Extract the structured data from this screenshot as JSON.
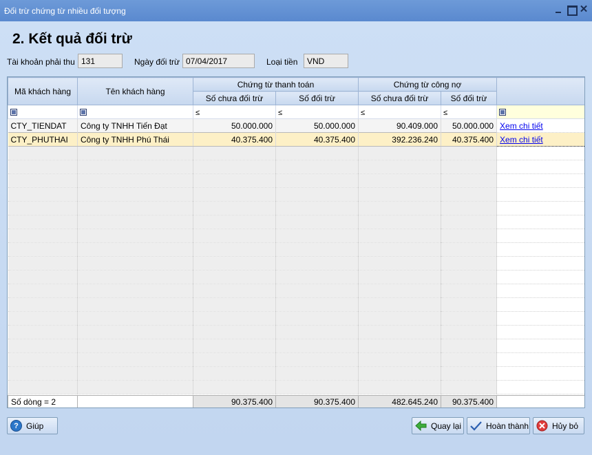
{
  "window": {
    "title": "Đối trừ chứng từ nhiều đối tượng"
  },
  "heading": "2. Kết quả đối trừ",
  "fields": {
    "account_label": "Tài khoản phải thu",
    "account_value": "131",
    "date_label": "Ngày đối trừ",
    "date_value": "07/04/2017",
    "currency_label": "Loại tiền",
    "currency_value": "VND"
  },
  "grid": {
    "headers": {
      "customer_code": "Mã khách hàng",
      "customer_name": "Tên khách hàng",
      "payment_group": "Chứng từ thanh toán",
      "debt_group": "Chứng từ công nợ",
      "unoffset": "Số chưa đối trừ",
      "offset": "Số đối trừ"
    },
    "filter_operator": "≤",
    "rows": [
      {
        "code": "CTY_TIENDAT",
        "name": "Công ty TNHH Tiến Đạt",
        "pay_unoffset": "50.000.000",
        "pay_offset": "50.000.000",
        "debt_unoffset": "90.409.000",
        "debt_offset": "50.000.000",
        "link": "Xem chi tiết"
      },
      {
        "code": "CTY_PHUTHAI",
        "name": "Công ty TNHH Phú Thái",
        "pay_unoffset": "40.375.400",
        "pay_offset": "40.375.400",
        "debt_unoffset": "392.236.240",
        "debt_offset": "40.375.400",
        "link": "Xem chi tiết"
      }
    ],
    "footer": {
      "row_count": "Số dòng = 2",
      "pay_unoffset": "90.375.400",
      "pay_offset": "90.375.400",
      "debt_unoffset": "482.645.240",
      "debt_offset": "90.375.400"
    }
  },
  "buttons": {
    "help": "Giúp",
    "back": "Quay lại",
    "finish": "Hoàn thành",
    "cancel": "Hủy bỏ"
  },
  "colors": {
    "accent": "#5a89cf",
    "selected_row": "#fdf0c6"
  }
}
